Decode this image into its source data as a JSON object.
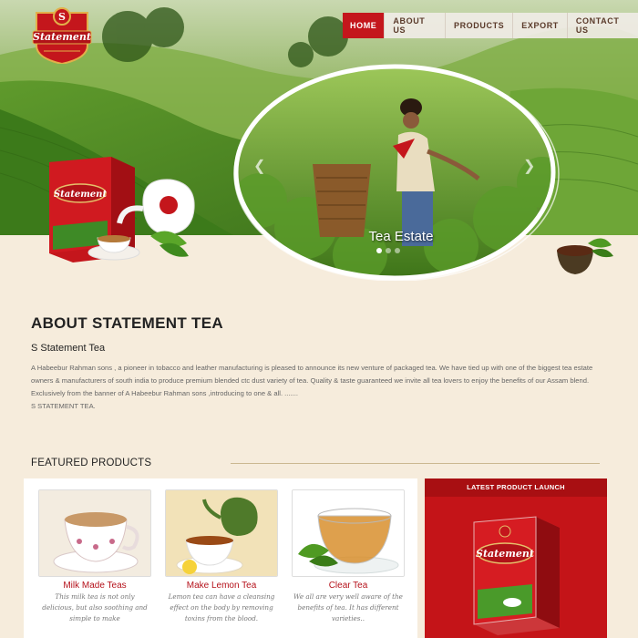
{
  "brand": {
    "logo_text": "Statement"
  },
  "nav": {
    "items": [
      {
        "label": "HOME",
        "active": true
      },
      {
        "label": "ABOUT US",
        "active": false
      },
      {
        "label": "PRODUCTS",
        "active": false
      },
      {
        "label": "EXPORT",
        "active": false
      },
      {
        "label": "CONTACT US",
        "active": false
      }
    ]
  },
  "slider": {
    "caption": "Tea Estate",
    "slide_count": 3,
    "active_slide": 1
  },
  "about": {
    "title": "ABOUT STATEMENT TEA",
    "subtitle": "S Statement Tea",
    "body": "A Habeebur Rahman sons , a pioneer in tobacco and leather manufacturing is pleased to announce its new venture of packaged tea. We have tied up with one of the biggest tea estate owners & manufacturers of south india to produce premium blended ctc dust variety of tea. Quality & taste guaranteed we invite all tea lovers to enjoy the benefits of our Assam blend. Exclusively from the banner of A Habeebur Rahman sons ,introducing to one & all. .......",
    "signature": "S STATEMENT TEA."
  },
  "featured": {
    "title": "FEATURED PRODUCTS",
    "products": [
      {
        "title": "Milk Made Teas",
        "desc": "This milk tea is not only delicious, but also soothing and simple to make"
      },
      {
        "title": "Make Lemon Tea",
        "desc": "Lemon tea can have a cleansing effect on the body by removing toxins from the blood."
      },
      {
        "title": "Clear Tea",
        "desc": "We all are very well aware of the benefits of tea. It has different varieties.."
      }
    ]
  },
  "launch": {
    "title": "LATEST PRODUCT LAUNCH"
  },
  "colors": {
    "brand_red": "#c4161c",
    "cream": "#f6ecdc",
    "tea_green": "#4f8a2a"
  }
}
